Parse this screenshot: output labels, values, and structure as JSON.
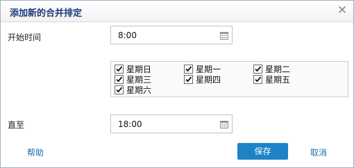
{
  "dialog": {
    "title": "添加新的合并排定",
    "close_icon": "close-icon"
  },
  "form": {
    "start_label": "开始时间",
    "start_value": "8:00",
    "end_label": "直至",
    "end_value": "18:00",
    "days": [
      {
        "label": "星期日",
        "checked": true
      },
      {
        "label": "星期一",
        "checked": true
      },
      {
        "label": "星期二",
        "checked": true
      },
      {
        "label": "星期三",
        "checked": true
      },
      {
        "label": "星期四",
        "checked": true
      },
      {
        "label": "星期五",
        "checked": true
      },
      {
        "label": "星期六",
        "checked": true
      }
    ]
  },
  "footer": {
    "help_label": "帮助",
    "save_label": "保存",
    "cancel_label": "取消"
  },
  "colors": {
    "title": "#1d3a78",
    "link": "#1a6ea8",
    "primary_button": "#1c84c6"
  }
}
